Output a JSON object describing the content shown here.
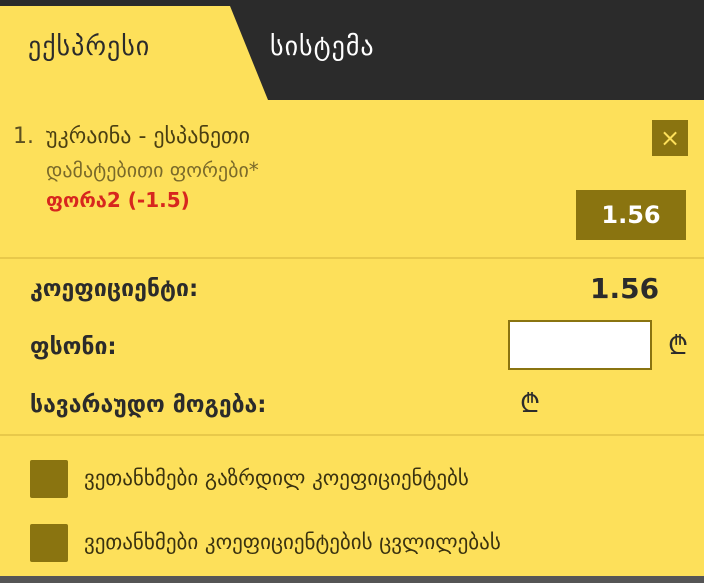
{
  "tabs": {
    "express": "ექსპრესი",
    "system": "სისტემა"
  },
  "bet": {
    "index": "1.",
    "event": "უკრაინა - ესპანეთი",
    "market": "დამატებითი ფორები*",
    "selection": "ფორა2 (-1.5)",
    "odds": "1.56",
    "remove_icon": "×"
  },
  "summary": {
    "coefficient_label": "კოეფიციენტი:",
    "coefficient_value": "1.56",
    "stake_label": "ფსონი:",
    "stake_value": "",
    "payout_label": "სავარაუდო მოგება:",
    "currency_symbol": "₾"
  },
  "options": [
    {
      "label": "ვეთანხმები გაზრდილ კოეფიციენტებს"
    },
    {
      "label": "ვეთანხმები კოეფიციენტების ცვლილებას"
    }
  ],
  "colors": {
    "panel": "#fde05a",
    "dark": "#2b2b2b",
    "accent": "#8a7410",
    "selection": "#d7261e"
  }
}
